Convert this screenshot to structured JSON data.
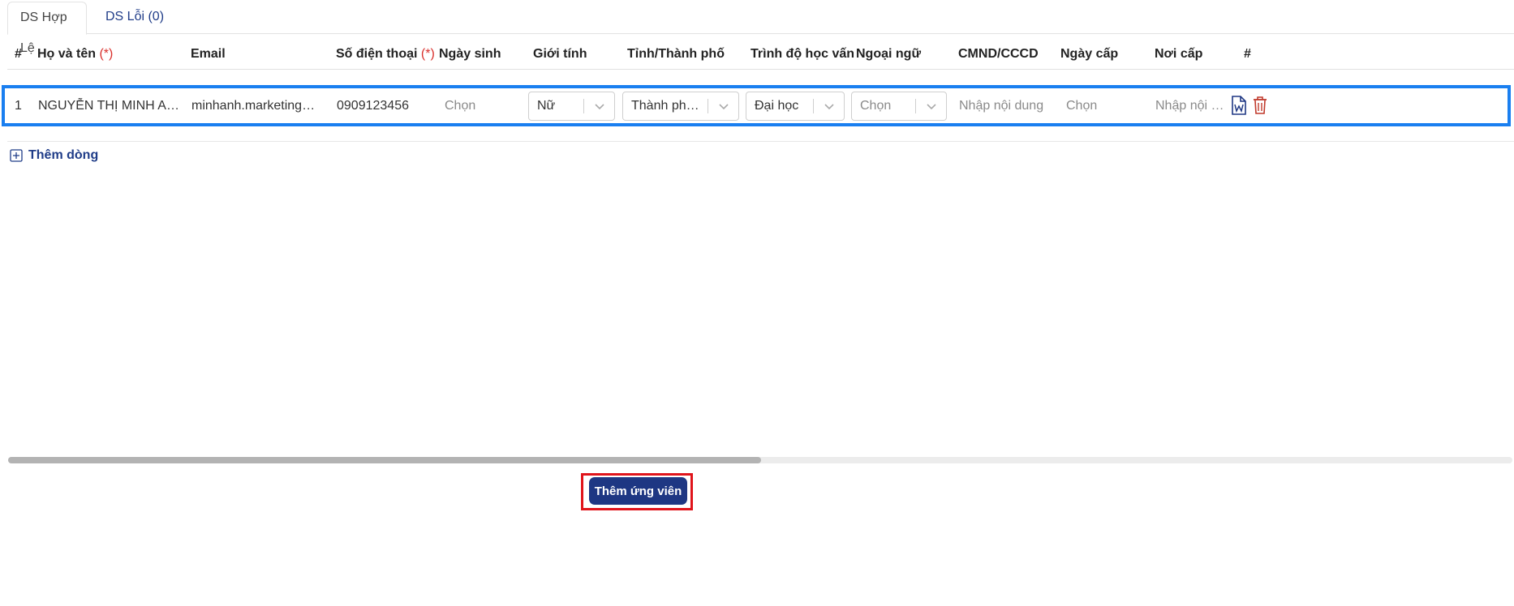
{
  "tabs": [
    {
      "label": "DS Hợp Lệ",
      "active": true
    },
    {
      "label": "DS Lỗi (0)",
      "active": false
    }
  ],
  "header": {
    "index": "#",
    "name": "Họ và tên",
    "name_required": "(*)",
    "email": "Email",
    "phone": "Số điện thoại",
    "phone_required": "(*)",
    "birthday": "Ngày sinh",
    "gender": "Giới tính",
    "province": "Tỉnh/Thành phố",
    "education": "Trình độ học vấn",
    "language": "Ngoại ngữ",
    "id_card": "CMND/CCCD",
    "issue_date": "Ngày cấp",
    "issue_place": "Nơi cấp",
    "actions": "#"
  },
  "rows": [
    {
      "index": "1",
      "name": "NGUYỄN THỊ MINH ANH",
      "email": "minhanh.marketing@...",
      "phone": "0909123456",
      "birthday_placeholder": "Chọn",
      "gender": "Nữ",
      "province": "Thành phố...",
      "education": "Đại học",
      "language_placeholder": "Chọn",
      "id_card_placeholder": "Nhập nội dung",
      "issue_date_placeholder": "Chọn",
      "issue_place_placeholder": "Nhập nội du..."
    }
  ],
  "add_row_label": "Thêm dòng",
  "scroll": {
    "position": 0.0,
    "visible_fraction": 0.5
  },
  "submit_label": "Thêm ứng viên",
  "colors": {
    "primary": "#1e3783",
    "link": "#1f3c88",
    "required": "#d9302c",
    "row_highlight": "#1a7ff0",
    "button_highlight": "#e0141b",
    "delete": "#c0392b"
  },
  "icons": {
    "chevron": "chevron-down-icon",
    "word": "word-file-icon",
    "delete": "trash-icon",
    "add": "plus-square-icon"
  }
}
